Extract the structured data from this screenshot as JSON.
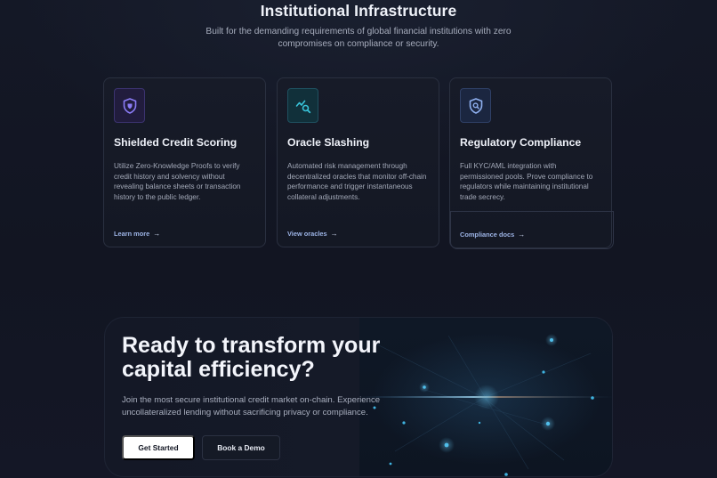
{
  "section": {
    "title": "Institutional Infrastructure",
    "subtitle": "Built for the demanding requirements of global financial institutions with zero compromises on compliance or security."
  },
  "cards": [
    {
      "icon": "shield-icon",
      "title": "Shielded Credit Scoring",
      "body": "Utilize Zero-Knowledge Proofs to verify credit history and solvency without revealing balance sheets or transaction history to the public ledger.",
      "link": "Learn more",
      "accent": "#8b7cf6"
    },
    {
      "icon": "chart-search-icon",
      "title": "Oracle Slashing",
      "body": "Automated risk management through decentralized oracles that monitor off-chain performance and trigger instantaneous collateral adjustments.",
      "link": "View oracles",
      "accent": "#38c2d8"
    },
    {
      "icon": "shield-search-icon",
      "title": "Regulatory Compliance",
      "body": "Full KYC/AML integration with permissioned pools. Prove compliance to regulators while maintaining institutional trade secrecy.",
      "link": "Compliance docs",
      "accent": "#8fb0f0"
    }
  ],
  "cta": {
    "title": "Ready to transform your capital efficiency?",
    "subtitle": "Join the most secure institutional credit market on-chain. Experience uncollateralized lending without sacrificing privacy or compliance.",
    "primary_label": "Get Started",
    "secondary_label": "Book a Demo"
  },
  "colors": {
    "background": "#11141f",
    "link": "#9db4e6",
    "primary_button": "#ffffff"
  }
}
